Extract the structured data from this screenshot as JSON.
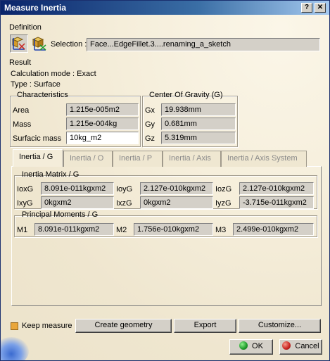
{
  "window": {
    "title": "Measure Inertia",
    "help_label": "?",
    "close_label": "✕"
  },
  "definition": {
    "label": "Definition",
    "selection_label": "Selection :",
    "selection_value": "Face...EdgeFillet.3....renaming_a_sketch"
  },
  "result": {
    "label": "Result",
    "calc_mode": "Calculation mode :  Exact",
    "type": "Type :  Surface"
  },
  "characteristics": {
    "label": "Characteristics",
    "area_label": "Area",
    "area_value": "1.215e-005m2",
    "mass_label": "Mass",
    "mass_value": "1.215e-004kg",
    "surfmass_label": "Surfacic mass",
    "surfmass_value": "10kg_m2"
  },
  "cog": {
    "label": "Center Of Gravity (G)",
    "gx_label": "Gx",
    "gx_value": "19.938mm",
    "gy_label": "Gy",
    "gy_value": "0.681mm",
    "gz_label": "Gz",
    "gz_value": "5.319mm"
  },
  "tabs": [
    {
      "label": "Inertia / G"
    },
    {
      "label": "Inertia / O"
    },
    {
      "label": "Inertia / P"
    },
    {
      "label": "Inertia / Axis"
    },
    {
      "label": "Inertia / Axis System"
    }
  ],
  "matrix": {
    "label": "Inertia Matrix / G",
    "ioxg_label": "IoxG",
    "ioxg_value": "8.091e-011kgxm2",
    "ioyg_label": "IoyG",
    "ioyg_value": "2.127e-010kgxm2",
    "iozg_label": "IozG",
    "iozg_value": "2.127e-010kgxm2",
    "ixyg_label": "IxyG",
    "ixyg_value": "0kgxm2",
    "ixzg_label": "IxzG",
    "ixzg_value": "0kgxm2",
    "iyzg_label": "IyzG",
    "iyzg_value": "-3.715e-011kgxm2"
  },
  "moments": {
    "label": "Principal Moments / G",
    "m1_label": "M1",
    "m1_value": "8.091e-011kgxm2",
    "m2_label": "M2",
    "m2_value": "1.756e-010kgxm2",
    "m3_label": "M3",
    "m3_value": "2.499e-010kgxm2"
  },
  "bottom": {
    "keep_label": "Keep measure",
    "create_label": "Create geometry",
    "export_label": "Export",
    "customize_label": "Customize...",
    "ok_label": "OK",
    "cancel_label": "Cancel"
  },
  "colors": {
    "title_start": "#0a246a",
    "title_end": "#a6caf0",
    "ok_green": "#1f9a2a",
    "cancel_red": "#c8221f",
    "checkbox": "#e9a63a"
  }
}
